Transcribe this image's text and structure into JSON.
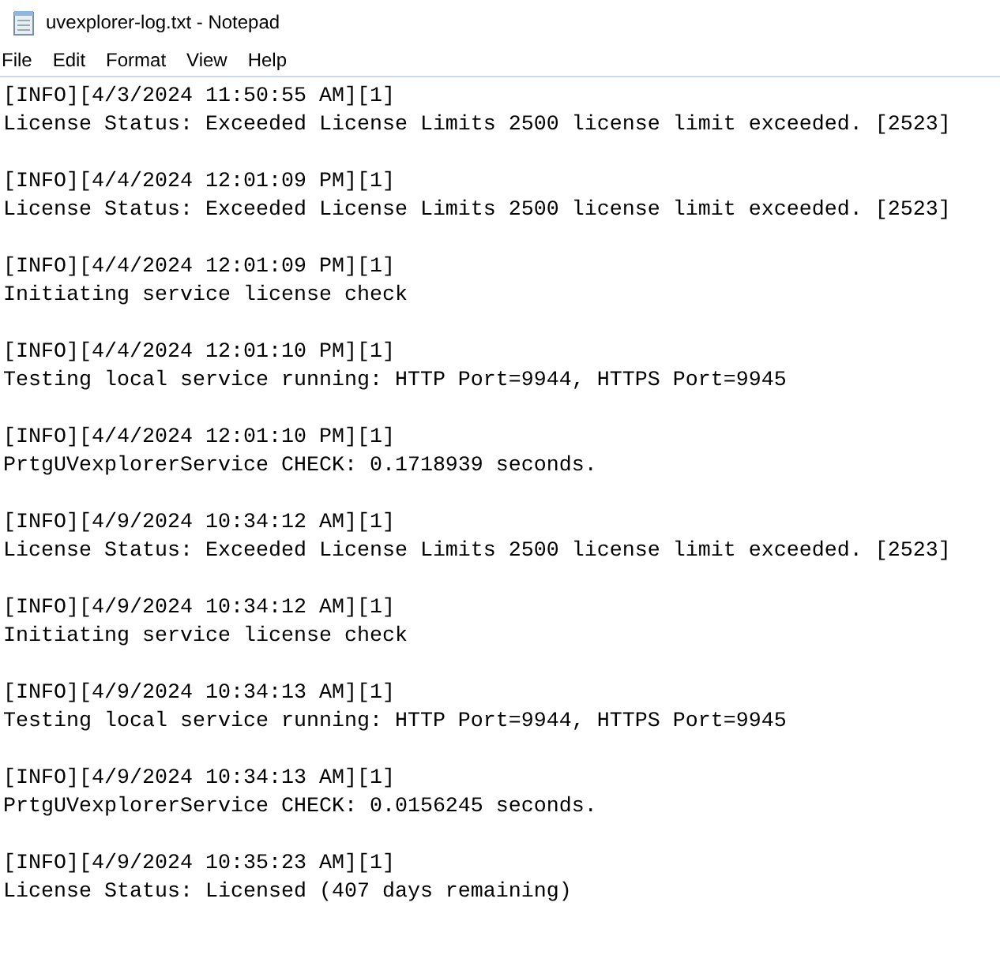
{
  "window": {
    "title": "uvexplorer-log.txt - Notepad"
  },
  "menu": [
    "File",
    "Edit",
    "Format",
    "View",
    "Help"
  ],
  "entries": [
    {
      "header": "[INFO][4/3/2024 11:50:55 AM][1]",
      "message": "License Status: Exceeded License Limits 2500 license limit exceeded. [2523]"
    },
    {
      "header": "[INFO][4/4/2024 12:01:09 PM][1]",
      "message": "License Status: Exceeded License Limits 2500 license limit exceeded. [2523]"
    },
    {
      "header": "[INFO][4/4/2024 12:01:09 PM][1]",
      "message": "Initiating service license check"
    },
    {
      "header": "[INFO][4/4/2024 12:01:10 PM][1]",
      "message": "Testing local service running: HTTP Port=9944, HTTPS Port=9945"
    },
    {
      "header": "[INFO][4/4/2024 12:01:10 PM][1]",
      "message": "PrtgUVexplorerService CHECK: 0.1718939 seconds."
    },
    {
      "header": "[INFO][4/9/2024 10:34:12 AM][1]",
      "message": "License Status: Exceeded License Limits 2500 license limit exceeded. [2523]"
    },
    {
      "header": "[INFO][4/9/2024 10:34:12 AM][1]",
      "message": "Initiating service license check"
    },
    {
      "header": "[INFO][4/9/2024 10:34:13 AM][1]",
      "message": "Testing local service running: HTTP Port=9944, HTTPS Port=9945"
    },
    {
      "header": "[INFO][4/9/2024 10:34:13 AM][1]",
      "message": "PrtgUVexplorerService CHECK: 0.0156245 seconds."
    },
    {
      "header": "[INFO][4/9/2024 10:35:23 AM][1]",
      "message": "License Status: Licensed (407 days remaining)"
    }
  ]
}
